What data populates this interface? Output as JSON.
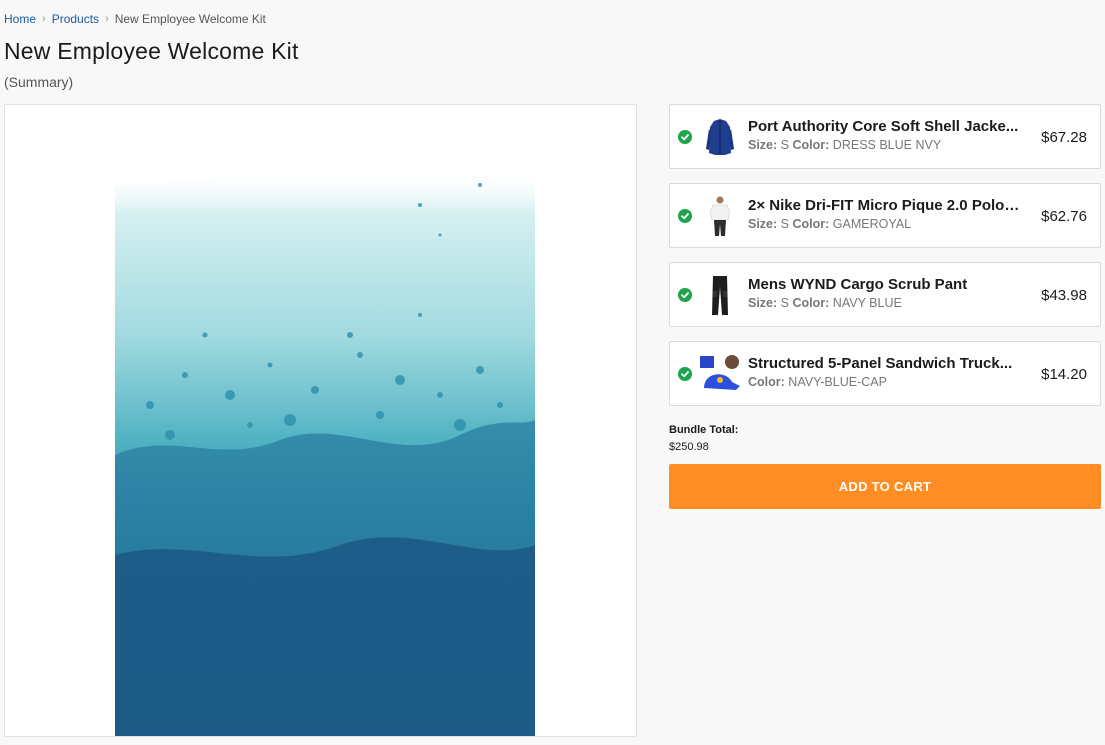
{
  "breadcrumb": {
    "home": "Home",
    "products": "Products",
    "current": "New Employee Welcome Kit"
  },
  "title": "New Employee Welcome Kit",
  "subtitle": "(Summary)",
  "items": [
    {
      "name": "Port Authority Core Soft Shell Jacke...",
      "attr1_label": "Size:",
      "attr1_value": "S",
      "attr2_label": "Color:",
      "attr2_value": "DRESS BLUE NVY",
      "price": "$67.28",
      "thumb": "jacket-thumbnail"
    },
    {
      "name": "2× Nike Dri-FIT Micro Pique 2.0 Polo ...",
      "attr1_label": "Size:",
      "attr1_value": "S",
      "attr2_label": "Color:",
      "attr2_value": "GAMEROYAL",
      "price": "$62.76",
      "thumb": "polo-thumbnail"
    },
    {
      "name": "Mens WYND Cargo Scrub Pant",
      "attr1_label": "Size:",
      "attr1_value": "S",
      "attr2_label": "Color:",
      "attr2_value": "NAVY BLUE",
      "price": "$43.98",
      "thumb": "pants-thumbnail"
    },
    {
      "name": "Structured 5-Panel Sandwich Truck...",
      "attr2_label": "Color:",
      "attr2_value": "NAVY-BLUE-CAP",
      "price": "$14.20",
      "thumb": "cap-thumbnail"
    }
  ],
  "bundle": {
    "label": "Bundle Total:",
    "value": "$250.98"
  },
  "add_to_cart": "ADD TO CART",
  "colors": {
    "accent": "#ff8d24",
    "check": "#1ea44a",
    "link": "#1f5aa6"
  }
}
